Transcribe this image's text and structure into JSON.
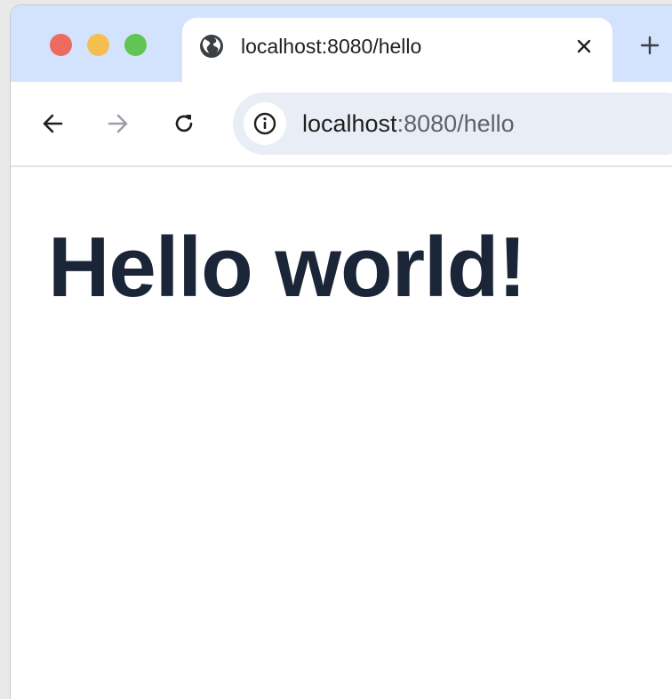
{
  "window": {
    "traffic_lights": [
      "close",
      "minimize",
      "zoom"
    ]
  },
  "tab": {
    "title": "localhost:8080/hello",
    "favicon_icon": "globe-icon",
    "close_glyph": "×"
  },
  "new_tab": {
    "glyph": "+"
  },
  "toolbar": {
    "back_icon": "arrow-left-icon",
    "forward_icon": "arrow-right-icon",
    "reload_icon": "reload-icon",
    "site_info_icon": "info-icon"
  },
  "omnibox": {
    "host": "localhost",
    "rest": ":8080/hello"
  },
  "page": {
    "heading": "Hello world!"
  },
  "colors": {
    "tabbar_bg": "#d3e3fd",
    "omnibox_bg": "#e9eef6",
    "heading_text": "#1a2538",
    "traffic_red": "#ec6a5e",
    "traffic_yellow": "#f4bf4f",
    "traffic_green": "#61c554"
  }
}
